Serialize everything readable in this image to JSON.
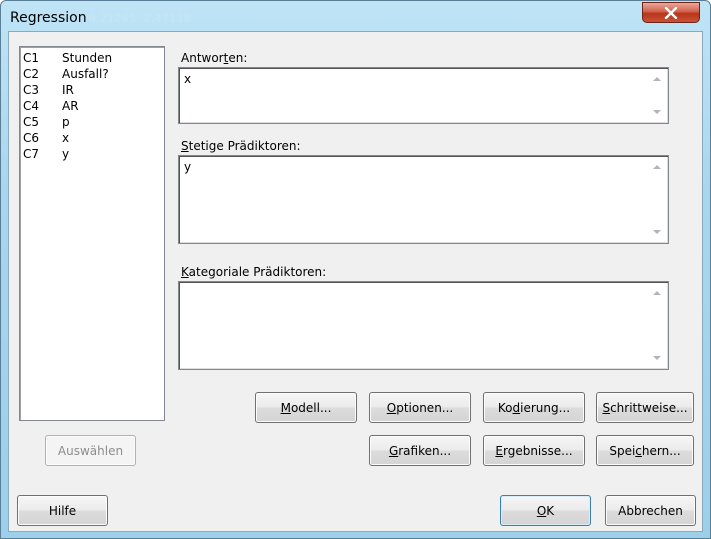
{
  "window": {
    "title": "Regression",
    "background_text": "6.21245   -2.47138"
  },
  "variables": [
    {
      "col": "C1",
      "name": "Stunden"
    },
    {
      "col": "C2",
      "name": "Ausfall?"
    },
    {
      "col": "C3",
      "name": "IR"
    },
    {
      "col": "C4",
      "name": "AR"
    },
    {
      "col": "C5",
      "name": "p"
    },
    {
      "col": "C6",
      "name": "x"
    },
    {
      "col": "C7",
      "name": "y"
    }
  ],
  "fields": {
    "responses": {
      "label_pre": "Antwor",
      "label_key": "t",
      "label_post": "en:",
      "value": "x"
    },
    "continuous": {
      "label_pre": "",
      "label_key": "S",
      "label_post": "tetige Prädiktoren:",
      "value": "y"
    },
    "categorical": {
      "label_pre": "",
      "label_key": "K",
      "label_post": "ategoriale Prädiktoren:",
      "value": ""
    }
  },
  "buttons": {
    "select": "Auswählen",
    "help": "Hilfe",
    "model": {
      "pre": "",
      "key": "M",
      "post": "odell..."
    },
    "options": {
      "pre": "",
      "key": "O",
      "post": "ptionen..."
    },
    "coding": {
      "pre": "Ko",
      "key": "d",
      "post": "ierung..."
    },
    "stepwise": {
      "pre": "",
      "key": "S",
      "post": "chrittweise..."
    },
    "graphs": {
      "pre": "",
      "key": "G",
      "post": "rafiken..."
    },
    "results": {
      "pre": "",
      "key": "E",
      "post": "rgebnisse..."
    },
    "storage": {
      "pre": "Spei",
      "key": "c",
      "post": "hern..."
    },
    "ok": {
      "pre": "",
      "key": "O",
      "post": "K"
    },
    "cancel": "Abbrechen"
  },
  "colors": {
    "title_bar": "#a9d6ee",
    "close_button": "#c9523a",
    "dialog_bg": "#f0f0f0"
  }
}
